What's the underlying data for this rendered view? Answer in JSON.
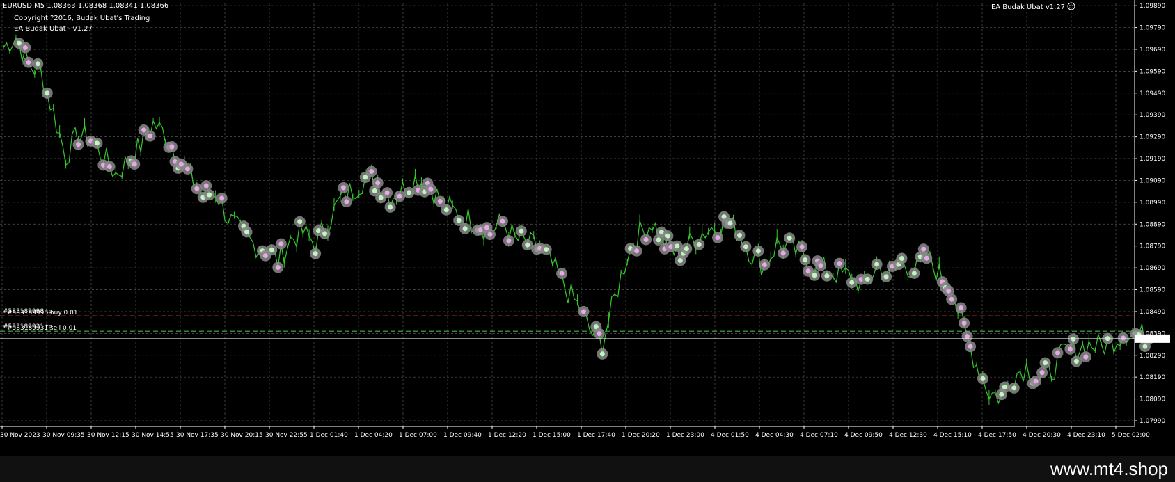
{
  "header": {
    "symbol_line": "EURUSD,M5  1.08363 1.08368 1.08341 1.08366",
    "copyright": "Copyright ?2016, Budak Ubat's Trading",
    "ea_name": "EA Budak Ubat - v1.27",
    "ea_badge": "EA Budak Ubat v1.27",
    "smiley_icon": "smiley-icon"
  },
  "orders": [
    {
      "label": "#583189998 tp",
      "sub": "#583189998 buy 0.01",
      "price": 1.0847,
      "color": "#e0402a"
    },
    {
      "label": "#583189931 tp",
      "sub": "#583189931 sell 0.01",
      "price": 1.084,
      "color": "#3fb53f"
    }
  ],
  "current_price": {
    "value": 1.08366,
    "label": "1.08366"
  },
  "watermark": "www.mt4.shop",
  "chart_data": {
    "type": "line",
    "ylim": [
      1.0799,
      1.099
    ],
    "y_ticks": [
      "1.09890",
      "1.09790",
      "1.09690",
      "1.09590",
      "1.09490",
      "1.09390",
      "1.09290",
      "1.09190",
      "1.09090",
      "1.08990",
      "1.08890",
      "1.08790",
      "1.08690",
      "1.08590",
      "1.08490",
      "1.08390",
      "1.08290",
      "1.08190",
      "1.08090",
      "1.07990"
    ],
    "x_ticks": [
      "30 Nov 2023",
      "30 Nov 09:35",
      "30 Nov 12:15",
      "30 Nov 14:55",
      "30 Nov 17:35",
      "30 Nov 20:15",
      "30 Nov 22:55",
      "1 Dec 01:40",
      "1 Dec 04:20",
      "1 Dec 07:00",
      "1 Dec 09:40",
      "1 Dec 12:20",
      "1 Dec 15:00",
      "1 Dec 17:40",
      "1 Dec 20:20",
      "1 Dec 23:00",
      "4 Dec 01:50",
      "4 Dec 04:30",
      "4 Dec 07:10",
      "4 Dec 09:50",
      "4 Dec 12:30",
      "4 Dec 15:10",
      "4 Dec 17:50",
      "4 Dec 20:30",
      "4 Dec 23:10",
      "5 Dec 02:00"
    ],
    "series": [
      {
        "values": [
          1.097,
          1.0975,
          1.0962,
          1.0958,
          1.094,
          1.092,
          1.093,
          1.0928,
          1.092,
          1.0912,
          1.0918,
          1.0925,
          1.0935,
          1.093,
          1.092,
          1.091,
          1.0902,
          1.0904,
          1.0892,
          1.0885,
          1.088,
          1.0878,
          1.0872,
          1.0882,
          1.0885,
          1.088,
          1.089,
          1.09,
          1.0905,
          1.091,
          1.0908,
          1.0902,
          1.0905,
          1.091,
          1.0908,
          1.09,
          1.0895,
          1.0892,
          1.089,
          1.0885,
          1.089,
          1.0882,
          1.088,
          1.0878,
          1.087,
          1.086,
          1.0852,
          1.084,
          1.0835,
          1.0855,
          1.0875,
          1.0885,
          1.089,
          1.088,
          1.0875,
          1.088,
          1.0885,
          1.0888,
          1.089,
          1.0885,
          1.0875,
          1.087,
          1.088,
          1.0878,
          1.0875,
          1.087,
          1.0868,
          1.0866,
          1.0865,
          1.086,
          1.087,
          1.0865,
          1.0872,
          1.0868,
          1.0874,
          1.0866,
          1.086,
          1.084,
          1.0825,
          1.0812,
          1.081,
          1.082,
          1.0824,
          1.0818,
          1.0822,
          1.083,
          1.0832,
          1.0834,
          1.0833,
          1.0836,
          1.084,
          1.0838
        ]
      }
    ]
  }
}
